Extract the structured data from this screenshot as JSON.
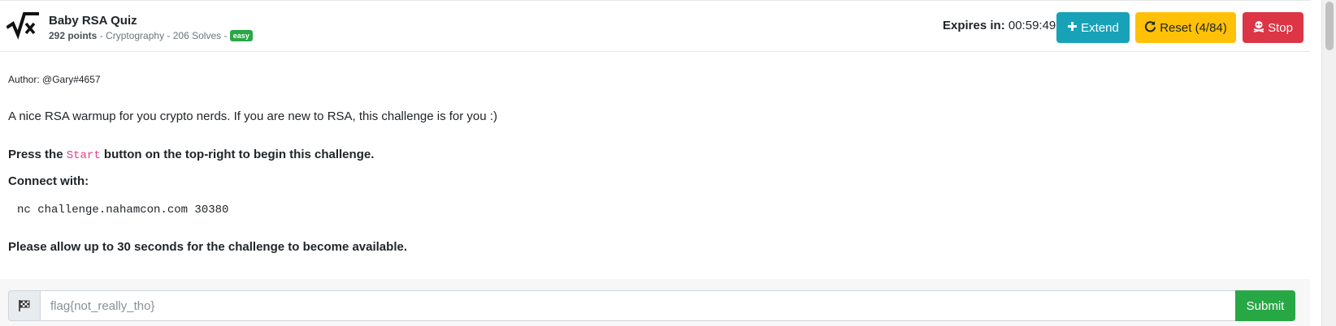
{
  "challenge": {
    "title": "Baby RSA Quiz",
    "points": "292 points",
    "category": "Cryptography",
    "solves": "206 Solves",
    "separator": " - ",
    "difficulty": "easy"
  },
  "header": {
    "expires_label": "Expires in",
    "expires_time": "00:59:49",
    "extend_label": "Extend",
    "reset_label": "Reset (4/84)",
    "stop_label": "Stop",
    "icons": {
      "extend": "plus-icon",
      "reset": "refresh-icon",
      "stop": "skull-icon",
      "logo": "sqrt-x-icon"
    },
    "colors": {
      "extend": "#17a2b8",
      "reset": "#ffc107",
      "stop": "#dc3545",
      "easy": "#28a745"
    }
  },
  "body": {
    "author": "Author: @Gary#4657",
    "description": "A nice RSA warmup for you crypto nerds. If you are new to RSA, this challenge is for you :)",
    "press_prefix": "Press the ",
    "press_code": "Start",
    "press_suffix": " button on the top-right to begin this challenge.",
    "connect_label": "Connect with:",
    "command": "nc challenge.nahamcon.com 30380",
    "allow_text": "Please allow up to 30 seconds for the challenge to become available."
  },
  "footer": {
    "flag_placeholder": "flag{not_really_tho}",
    "flag_value": "",
    "submit_label": "Submit",
    "flag_icon": "checkered-flag-icon"
  }
}
